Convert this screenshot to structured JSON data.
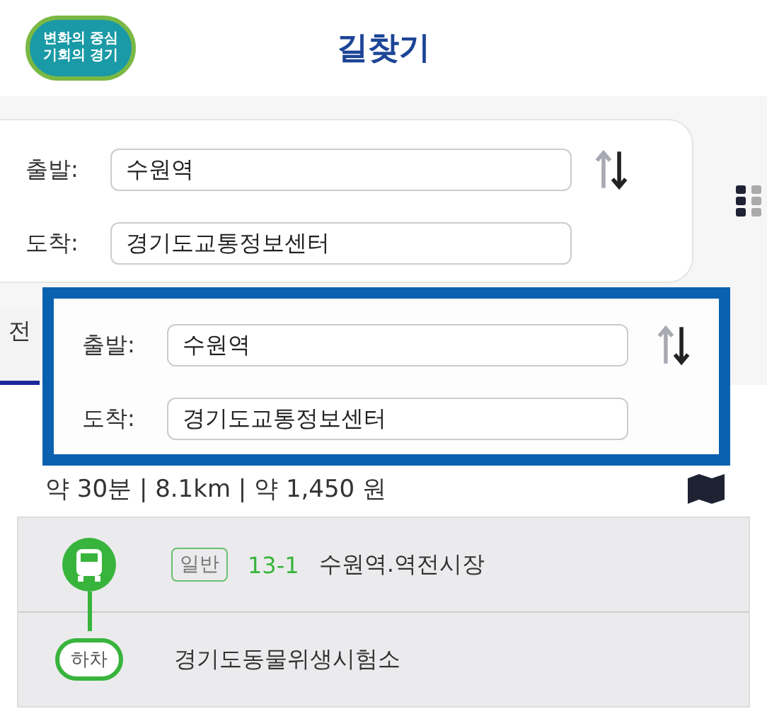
{
  "header": {
    "logo_lines": [
      "변화의 중심",
      "기회의 경기"
    ],
    "title": "길찾기"
  },
  "search": {
    "fields": [
      {
        "label": "출발:",
        "value": "수원역"
      },
      {
        "label": "도착:",
        "value": "경기도교통정보센터"
      }
    ]
  },
  "tabs": [
    {
      "label": "전",
      "selected": true
    }
  ],
  "summary": "약 30분 | 8.1km | 약 1,450 원",
  "callout": {
    "fields": [
      {
        "label": "출발:",
        "value": "수원역"
      },
      {
        "label": "도착:",
        "value": "경기도교통정보센터"
      }
    ]
  },
  "route": [
    {
      "kind": "bus",
      "badge": "일반",
      "number": "13-1",
      "stop": "수원역.역전시장"
    },
    {
      "kind": "alight",
      "marker": "하차",
      "stop": "경기도동물위생시험소"
    }
  ]
}
